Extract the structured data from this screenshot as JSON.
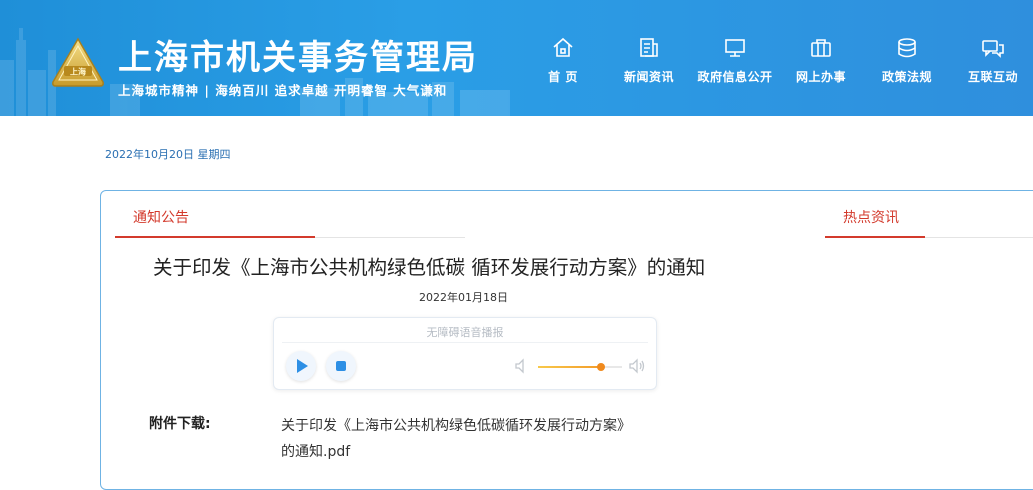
{
  "header": {
    "site_title": "上海市机关事务管理局",
    "slogan": "上海城市精神 | 海纳百川  追求卓越   开明睿智  大气谦和",
    "logo_text": "上海",
    "nav": [
      {
        "label": "首  页",
        "icon": "home-icon"
      },
      {
        "label": "新闻资讯",
        "icon": "news-icon"
      },
      {
        "label": "政府信息公开",
        "icon": "monitor-icon"
      },
      {
        "label": "网上办事",
        "icon": "briefcase-icon"
      },
      {
        "label": "政策法规",
        "icon": "database-icon"
      },
      {
        "label": "互联互动",
        "icon": "chat-icon"
      }
    ]
  },
  "date_line": "2022年10月20日 星期四",
  "content": {
    "tab_notice": "通知公告",
    "tab_hot": "热点资讯",
    "article_title": "关于印发《上海市公共机构绿色低碳 循环发展行动方案》的通知",
    "article_date": "2022年01月18日",
    "player": {
      "label": "无障碍语音播报",
      "volume": 0.75
    },
    "attachment_label": "附件下载:",
    "attachment_line1": "关于印发《上海市公共机构绿色低碳循环发展行动方案》",
    "attachment_line2": "的通知.pdf"
  },
  "colors": {
    "header_blue": "#2a9ee6",
    "accent_red": "#d33a2c",
    "date_blue": "#2a6fb2",
    "player_blue": "#2d8fe5",
    "volume_orange": "#f08a1d"
  }
}
